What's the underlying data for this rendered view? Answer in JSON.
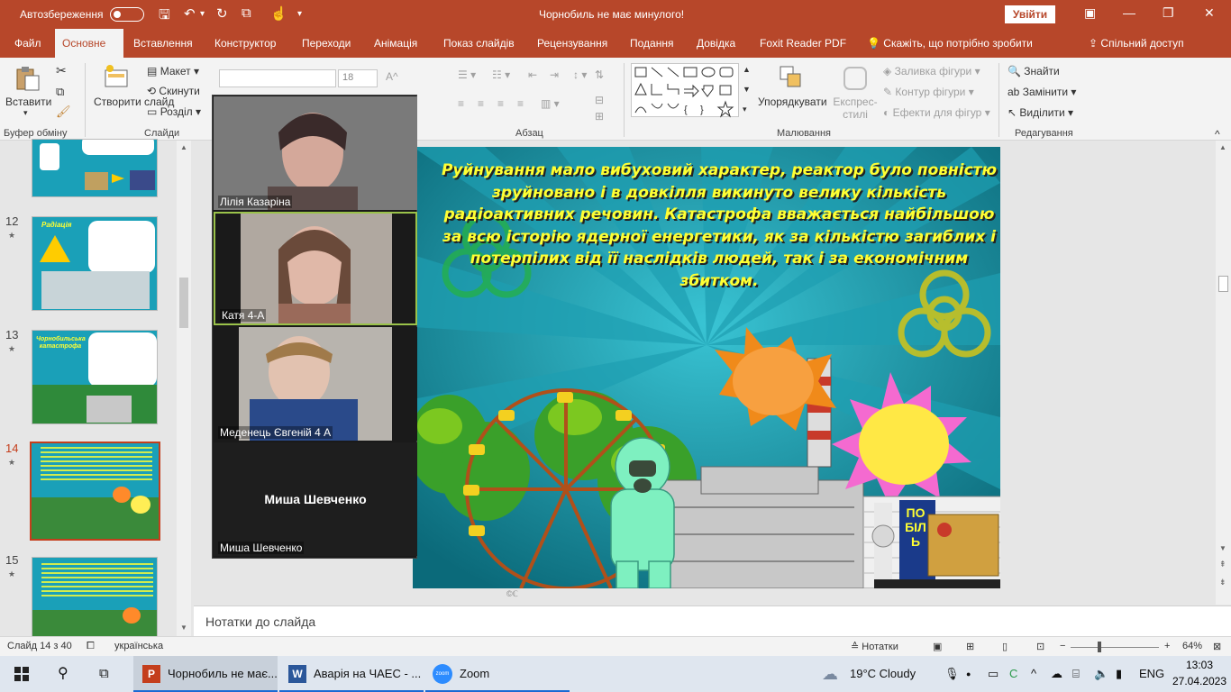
{
  "titlebar": {
    "autosave_label": "Автозбереження",
    "doc_title": "Чорнобиль не має минулого!",
    "signin_label": "Увійти"
  },
  "tabs": [
    "Файл",
    "Основне",
    "Вставлення",
    "Конструктор",
    "Переходи",
    "Анімація",
    "Показ слайдів",
    "Рецензування",
    "Подання",
    "Довідка",
    "Foxit Reader PDF"
  ],
  "tellme": "Скажіть, що потрібно зробити",
  "share": "Спільний доступ",
  "ribbon": {
    "paste": "Вставити",
    "clipboard_group": "Буфер обміну",
    "new_slide": "Створити слайд",
    "layout": "Макет",
    "reset": "Скинути",
    "section": "Розділ",
    "slides_group": "Слайди",
    "font_size": "18",
    "paragraph_group": "Абзац",
    "arrange": "Упорядкувати",
    "quick_styles": "Експрес-стилі",
    "shape_fill": "Заливка фігури",
    "shape_outline": "Контур фігури",
    "shape_effects": "Ефекти для фігур",
    "drawing_group": "Малювання",
    "find": "Знайти",
    "replace": "Замінити",
    "select": "Виділити",
    "editing_group": "Редагування"
  },
  "thumbnails": [
    {
      "num": "12",
      "title": "Радіація",
      "active": false
    },
    {
      "num": "13",
      "title": "Чорнобильська катастрофа",
      "active": false
    },
    {
      "num": "14",
      "title": "",
      "active": true
    },
    {
      "num": "15",
      "title": "",
      "active": false
    }
  ],
  "zoom": {
    "participants": [
      "Лілія Казаріна",
      "Катя  4-А",
      "Меденець Євгеній 4 А",
      "Миша Шевченко"
    ],
    "no_video_name": "Миша Шевченко"
  },
  "slide": {
    "text": "Руйнування мало вибуховий характер, реактор було повністю зруйновано і в довкілля викинуто велику кількість радіоактивних речовин. Катастрофа вважається найбільшою за всю історію ядерної енергетики, як за кількістю загиблих і потерпілих від її наслідків людей, так і за економічним збитком.",
    "sign": "ПОБІЛЬ",
    "footer_mark": "©ℂ"
  },
  "notes_label": "Нотатки до слайда",
  "status": {
    "slide_info": "Слайд 14 з 40",
    "language": "українська",
    "notes_btn": "Нотатки",
    "zoom_level": "64%"
  },
  "taskbar": {
    "apps": [
      "Чорнобиль не має...",
      "Аварія на ЧАЕС - ...",
      "Zoom"
    ],
    "weather": "19°C  Cloudy",
    "lang": "ENG",
    "time": "13:03",
    "date": "27.04.2023"
  },
  "colors": {
    "accent": "#b7472a",
    "slide_text": "#ffff33",
    "slide_bg": "#1a8a9a"
  }
}
